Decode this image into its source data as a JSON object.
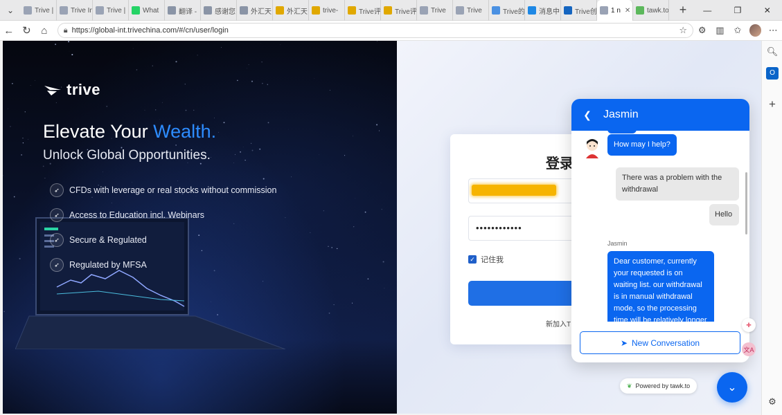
{
  "browser": {
    "tabs": [
      {
        "label": "Trive |",
        "color": "#9aa3b5"
      },
      {
        "label": "Trive In",
        "color": "#9aa3b5"
      },
      {
        "label": "Trive |",
        "color": "#9aa3b5"
      },
      {
        "label": "What",
        "color": "#25d366"
      },
      {
        "label": "翻译 -",
        "color": "#8a94a6"
      },
      {
        "label": "感谢您",
        "color": "#8a94a6"
      },
      {
        "label": "外汇天",
        "color": "#8a94a6"
      },
      {
        "label": "外汇天",
        "color": "#e0a800"
      },
      {
        "label": "trive-",
        "color": "#e0a800"
      },
      {
        "label": "Trive评",
        "color": "#e0a800"
      },
      {
        "label": "Trive评",
        "color": "#e0a800"
      },
      {
        "label": "Trive",
        "color": "#9aa3b5"
      },
      {
        "label": "Trive",
        "color": "#9aa3b5"
      },
      {
        "label": "Trive的",
        "color": "#4a90e2"
      },
      {
        "label": "消息中",
        "color": "#1e88e5"
      },
      {
        "label": "Trive创",
        "color": "#1565c0"
      },
      {
        "label": "1 n",
        "color": "#9aa3b5",
        "active": true
      },
      {
        "label": "tawk.to",
        "color": "#5cb85c"
      }
    ],
    "url": "https://global-int.trivechina.com/#/cn/user/login"
  },
  "promo": {
    "logo_text": "trive",
    "headline_part1": "Elevate Your ",
    "headline_accent": "Wealth.",
    "subheadline": "Unlock Global Opportunities.",
    "features": [
      "CFDs with leverage or real stocks without commission",
      "Access to Education incl. Webinars",
      "Secure & Regulated",
      "Regulated by MFSA"
    ],
    "accent_color": "#2d8cff"
  },
  "login": {
    "title": "登录",
    "password_mask": "••••••••••••",
    "remember_label": "记住我",
    "remember_checked": true,
    "join_text": "新加入T"
  },
  "chat": {
    "agent_name": "Jasmin",
    "messages": [
      {
        "from": "agent",
        "text": "How may I help?"
      },
      {
        "from": "user",
        "text": "There was a problem with the withdrawal"
      },
      {
        "from": "user",
        "text": "Hello"
      },
      {
        "from": "agent",
        "sender": "Jasmin",
        "text": "Dear customer, currently your requested is on waiting list. our withdrawal is in manual withdrawal mode, so the processing time will be relatively longer than"
      }
    ],
    "new_conversation_label": "New Conversation",
    "powered_by": "Powered by tawk.to",
    "brand_color": "#0a66f0"
  }
}
